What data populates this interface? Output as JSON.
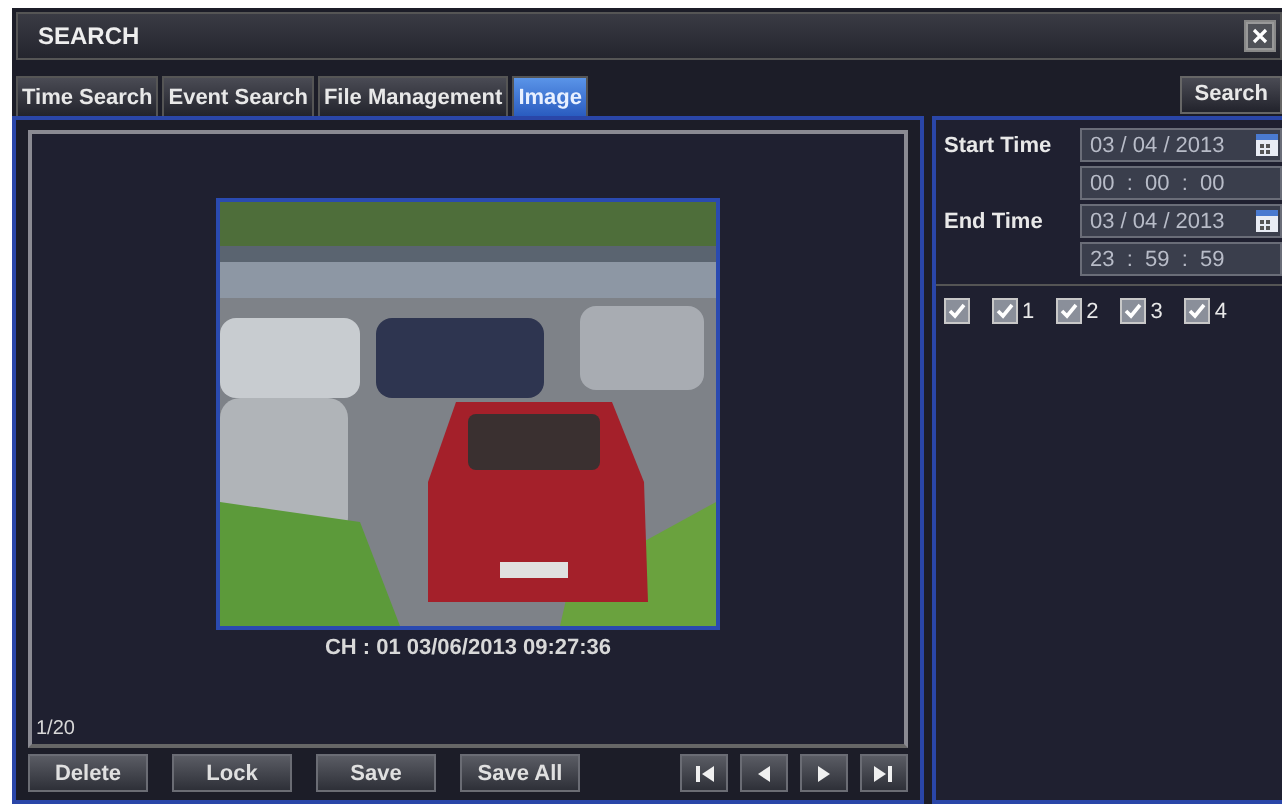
{
  "window": {
    "title": "SEARCH"
  },
  "tabs": [
    {
      "label": "Time Search",
      "selected": false
    },
    {
      "label": "Event Search",
      "selected": false
    },
    {
      "label": "File Management",
      "selected": false
    },
    {
      "label": "Image",
      "selected": true
    }
  ],
  "search_button": "Search",
  "filter": {
    "start": {
      "label": "Start Time",
      "date": "03 / 04 / 2013",
      "time": "00  :  00  :  00"
    },
    "end": {
      "label": "End Time",
      "date": "03 / 04 / 2013",
      "time": "23  :  59  :  59"
    },
    "select_all": {
      "checked": true
    },
    "channels": [
      {
        "label": "1",
        "checked": true
      },
      {
        "label": "2",
        "checked": true
      },
      {
        "label": "3",
        "checked": true
      },
      {
        "label": "4",
        "checked": true
      }
    ]
  },
  "preview": {
    "kind": "picture",
    "caption": "CH : 01  03/06/2013 09:27:36",
    "counter": "1/20"
  },
  "buttons": [
    "Delete",
    "Lock",
    "Save",
    "Save All"
  ],
  "nav": [
    {
      "kind": "first"
    },
    {
      "kind": "prev"
    },
    {
      "kind": "next"
    },
    {
      "kind": "last"
    }
  ]
}
